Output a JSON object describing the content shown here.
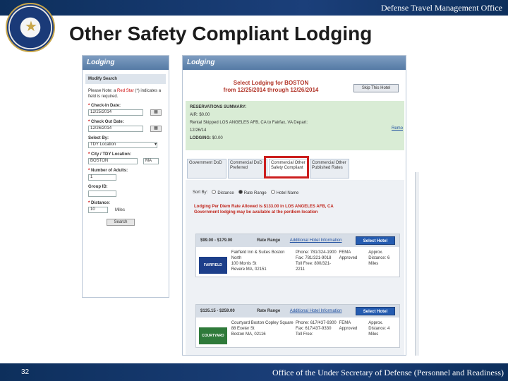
{
  "header": {
    "org": "Defense Travel Management Office"
  },
  "slide": {
    "title": "Other Safety Compliant Lodging",
    "page_number": "32"
  },
  "footer": {
    "text": "Office of the Under Secretary of Defense (Personnel and Readiness)"
  },
  "left_panel": {
    "title": "Lodging",
    "modify_search": "Modify Search",
    "note_a": "Please Note: a",
    "note_red_star": "Red Star",
    "note_star": " (*) ",
    "note_b": "indicates a field is required.",
    "checkin_label": "Check-In Date:",
    "checkin_value": "12/25/2014",
    "checkout_label": "Check Out Date:",
    "checkout_value": "12/26/2014",
    "selectby_label": "Select By:",
    "selectby_value": "TDY Location",
    "city_label": "City / TDY Location:",
    "city_value": "BOSTON",
    "state_value": "MA",
    "adults_label": "Number of Adults:",
    "adults_value": "1",
    "group_label": "Group ID:",
    "distance_label": "Distance:",
    "distance_value": "10",
    "miles": "Miles",
    "search_button": "Search"
  },
  "right_panel": {
    "title": "Lodging",
    "heading_1": "Select Lodging for BOSTON",
    "heading_2": "from 12/25/2014 through 12/26/2014",
    "skip_button": "Skip This Hotel",
    "summary": {
      "title": "RESERVATIONS SUMMARY:",
      "air": "AIR:",
      "air_value": "$0.00",
      "rental_text": "Rental Skipped",
      "route": "LOS ANGELES AFB, CA to Fairfax, VA Depart:",
      "date": "12/26/14",
      "lodging": "LODGING:",
      "lodging_value": "$0.00",
      "remove": "Remo"
    },
    "tabs": [
      "Government DoD",
      "Commercial DoD Preferred",
      "Commercial Other Safety Compliant",
      "Commercial Other Published Rates"
    ],
    "sort": {
      "label": "Sort By:",
      "opt1": "Distance",
      "opt2": "Rate Range",
      "opt3": "Hotel Name"
    },
    "perdiem_1": "Lodging Per Diem Rate Allowed is $133.00 in LOS ANGELES AFB, CA",
    "perdiem_2": "Government lodging may be available at the perdiem location",
    "hotels": [
      {
        "price": "$99.00 - $179.00",
        "rate_range": "Rate Range",
        "info": "Additional Hotel Information",
        "select": "Select Hotel",
        "logo": "FAIRFIELD",
        "name": "Fairfield Inn & Suites Boston North",
        "street": "100 Morris St",
        "city": "Revere MA, 02151",
        "phone": "Phone: 781/324-1900",
        "fax": "Fax: 781/321-9018",
        "tollfree": "Toll Free: 800/321-2211",
        "rate_type": "FEMA Approved",
        "distance": "Approx. Distance: 6 Miles"
      },
      {
        "price": "$135.15 - $259.00",
        "rate_range": "Rate Range",
        "info": "Additional Hotel Information",
        "select": "Select Hotel",
        "logo": "COURTYARD",
        "name": "Courtyard Boston Copley Square",
        "street": "88 Exeter St",
        "city": "Boston MA, 02116",
        "phone": "Phone: 617/437-9300",
        "fax": "Fax: 617/437-9330",
        "tollfree": "Toll Free:",
        "rate_type": "FEMA Approved",
        "distance": "Approx. Distance: 4 Miles"
      }
    ]
  },
  "colors": {
    "banner": "#1b3f7a",
    "highlight": "#cc1f1f",
    "accent_red": "#b2362a",
    "link": "#1f4fa0"
  }
}
